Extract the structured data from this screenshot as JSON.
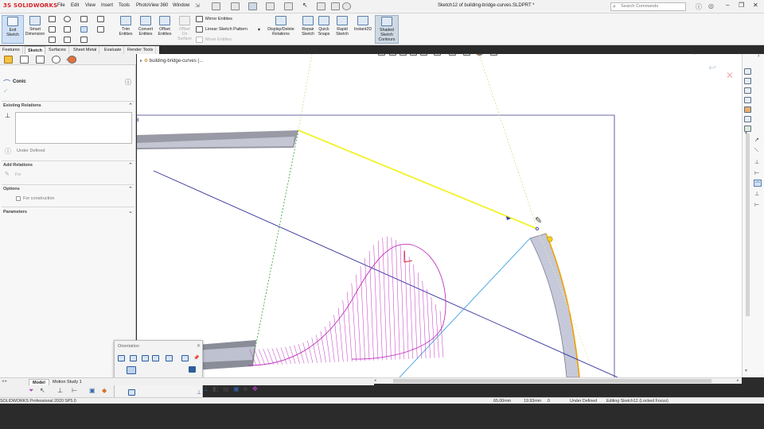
{
  "app": {
    "logo": "SOLIDWORKS",
    "document_title": "Sketch12 of building-bridge-curves.SLDPRT *",
    "search_placeholder": "Search Commands"
  },
  "menu": [
    "File",
    "Edit",
    "View",
    "Insert",
    "Tools",
    "PhotoView 360",
    "Window"
  ],
  "command_manager": {
    "exit_sketch": [
      "Exit",
      "Sketch"
    ],
    "smart_dimension": [
      "Smart",
      "Dimension"
    ],
    "trim_entities": [
      "Trim",
      "Entities"
    ],
    "convert_entities": [
      "Convert",
      "Entities"
    ],
    "offset_entities": [
      "Offset",
      "Entities"
    ],
    "offset_on_surface": [
      "Offset",
      "On",
      "Surface"
    ],
    "mirror_entities": "Mirror Entities",
    "linear_sketch_pattern": "Linear Sketch Pattern",
    "move_entities": "Move Entities",
    "display_delete_relations": [
      "Display/Delete",
      "Relations"
    ],
    "repair_sketch": [
      "Repair",
      "Sketch"
    ],
    "quick_snaps": [
      "Quick",
      "Snaps"
    ],
    "rapid_sketch": [
      "Rapid",
      "Sketch"
    ],
    "instant2d": "Instant2D",
    "shaded_sketch_contours": [
      "Shaded",
      "Sketch",
      "Contours"
    ]
  },
  "cm_tabs": [
    "Features",
    "Sketch",
    "Surfaces",
    "Sheet Metal",
    "Evaluate",
    "Render Tools"
  ],
  "cm_tab_active": "Sketch",
  "property_manager": {
    "title": "Conic",
    "existing_relations": "Existing Relations",
    "under_defined": "Under Defined",
    "add_relations": "Add Relations",
    "fix": "Fix",
    "options": "Options",
    "for_construction": "For construction",
    "parameters": "Parameters"
  },
  "tree": {
    "root": "building-bridge-curves  (..."
  },
  "orientation": {
    "title": "Orientation"
  },
  "bottom_tabs": [
    "Model",
    "Motion Study 1"
  ],
  "bottom_tab_active": "Model",
  "status": {
    "product": "SOLIDWORKS Professional 2020 SP5.0",
    "x": "65.00mm",
    "y": "19.93mm",
    "z": "0",
    "state": "Under Defined",
    "editing": "Editing Sketch12 (Locked Focus)"
  },
  "colors": {
    "logo_red": "#d8232a",
    "sketch_yellow": "#f2f22a",
    "construction_green": "#2e9e2e",
    "curvature_comb": "#c032c0",
    "conic_orange": "#f0a000",
    "centerline_blue": "#30309a",
    "light_blue": "#3aa0e0"
  }
}
